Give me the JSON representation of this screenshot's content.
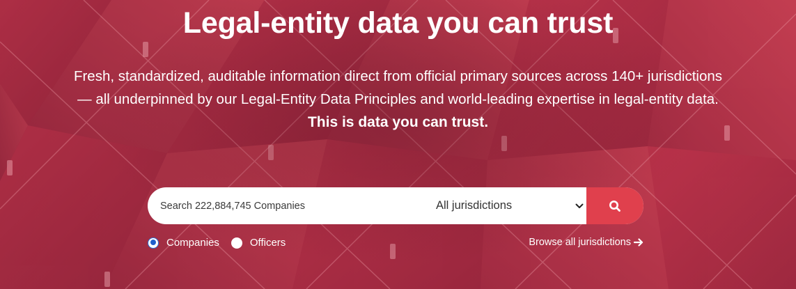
{
  "hero": {
    "title": "Legal-entity data you can trust",
    "subtitle_line1": "Fresh, standardized, auditable information direct from official primary sources across 140+ jurisdictions",
    "subtitle_line2": "— all underpinned by our Legal-Entity Data Principles and world-leading expertise in legal-entity data.",
    "subtitle_line3": "This is data you can trust."
  },
  "search": {
    "placeholder": "Search 222,884,745 Companies",
    "jurisdiction_selected": "All jurisdictions",
    "button_icon": "search-icon"
  },
  "search_type": {
    "options": [
      {
        "label": "Companies",
        "checked": true
      },
      {
        "label": "Officers",
        "checked": false
      }
    ]
  },
  "browse": {
    "label": "Browse all jurisdictions",
    "icon": "arrow-right-icon"
  },
  "colors": {
    "accent": "#e0404d",
    "background": "#a92c45",
    "radio_checked": "#1f5fcc"
  }
}
